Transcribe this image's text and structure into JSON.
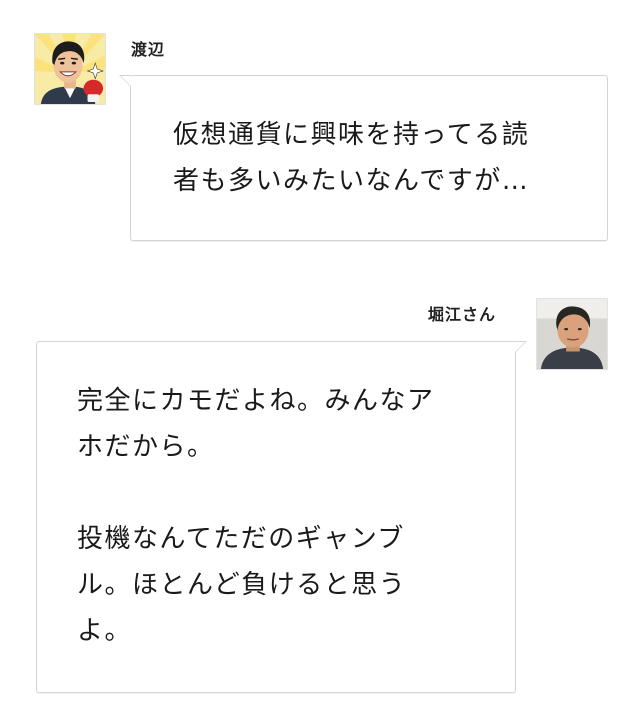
{
  "conversation": {
    "messages": [
      {
        "speaker": "渡辺",
        "avatar_icon": "illustrated-man-boxing-glove-icon",
        "lines": [
          "仮想通貨に興味を持ってる読",
          "者も多いみたいなんですが…"
        ]
      },
      {
        "speaker": "堀江さん",
        "avatar_icon": "man-photo-icon",
        "lines": [
          "完全にカモだよね。みんなア",
          "ホだから。",
          "",
          "投機なんてただのギャンブ",
          "ル。ほとんど負けると思う",
          "よ。"
        ]
      }
    ]
  },
  "colors": {
    "background": "#ffffff",
    "bubble_border": "#d4d4d4",
    "text": "#1a1a1a"
  }
}
